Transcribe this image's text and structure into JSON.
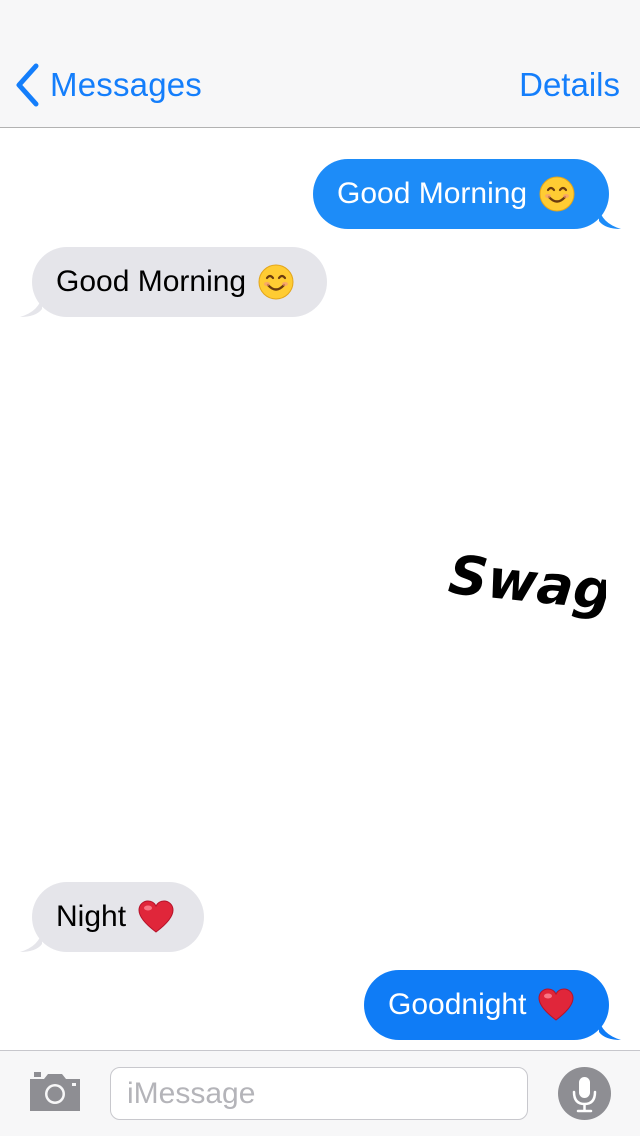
{
  "nav": {
    "back_label": "Messages",
    "details_label": "Details",
    "accent_color": "#147efb"
  },
  "messages": [
    {
      "direction": "outgoing",
      "text": "Good Morning",
      "emoji": "smiling-face-icon"
    },
    {
      "direction": "incoming",
      "text": "Good Morning",
      "emoji": "smiling-face-icon"
    },
    {
      "direction": "incoming",
      "text": "Night",
      "emoji": "red-heart-icon"
    },
    {
      "direction": "outgoing",
      "text": "Goodnight",
      "emoji": "red-heart-icon"
    }
  ],
  "overlay_text": "Swag",
  "composer": {
    "placeholder": "iMessage",
    "value": ""
  },
  "colors": {
    "outgoing_bubble": "#1d8cf8",
    "incoming_bubble": "#e5e5ea",
    "heart": "#e0263a"
  }
}
